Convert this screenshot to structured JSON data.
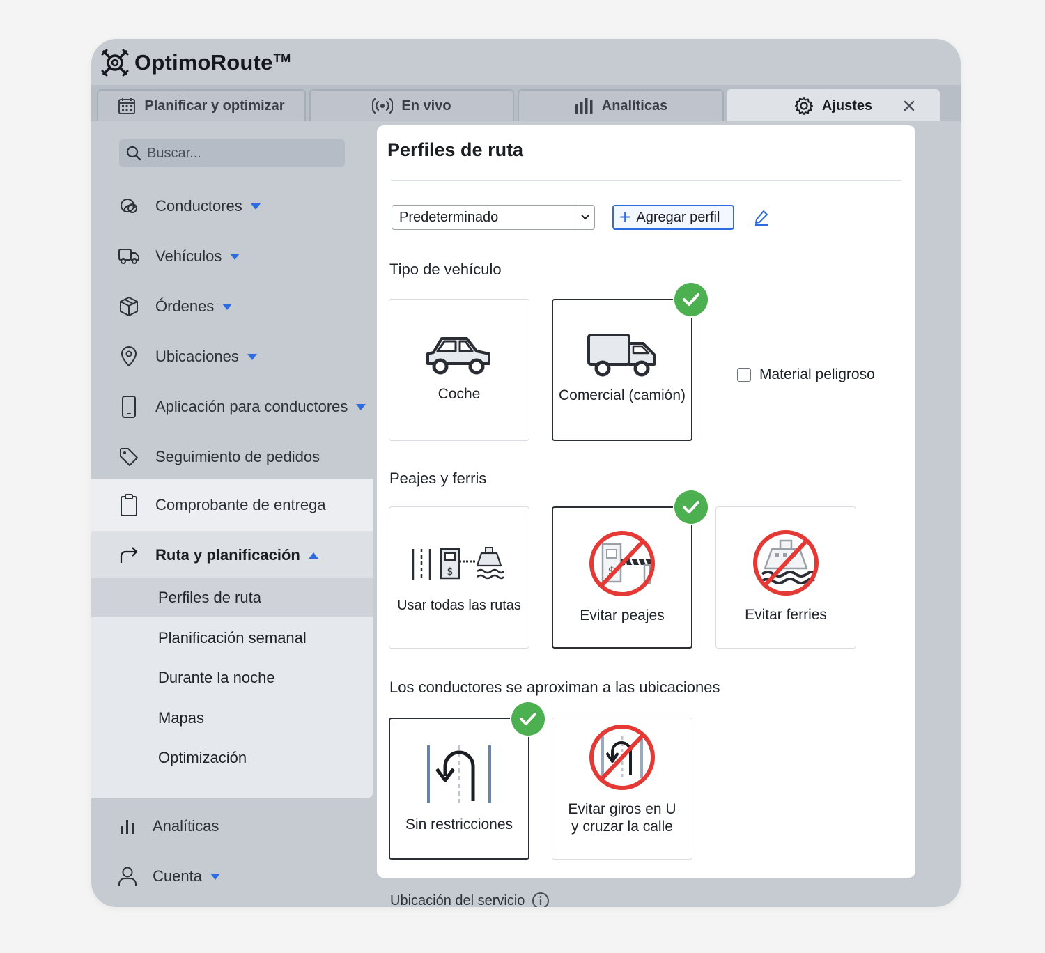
{
  "app": {
    "brand_name": "OptimoRoute",
    "brand_tm": "TM"
  },
  "tabs": [
    {
      "label": "Planificar y optimizar",
      "icon": "calendar-icon",
      "active": false
    },
    {
      "label": "En vivo",
      "icon": "broadcast-icon",
      "active": false
    },
    {
      "label": "Analíticas",
      "icon": "bar-chart-icon",
      "active": false
    },
    {
      "label": "Ajustes",
      "icon": "gear-icon",
      "active": true
    }
  ],
  "sidebar": {
    "search_placeholder": "Buscar...",
    "items": [
      {
        "label": "Conductores",
        "icon": "drivers-icon",
        "caret": "down"
      },
      {
        "label": "Vehículos",
        "icon": "truck-icon",
        "caret": "down"
      },
      {
        "label": "Órdenes",
        "icon": "box-icon",
        "caret": "down"
      },
      {
        "label": "Ubicaciones",
        "icon": "location-pin-icon",
        "caret": "down"
      },
      {
        "label": "Aplicación para conductores",
        "icon": "phone-icon",
        "caret": "down"
      },
      {
        "label": "Seguimiento de pedidos",
        "icon": "tag-icon",
        "caret": "none"
      },
      {
        "label": "Comprobante de entrega",
        "icon": "clipboard-icon",
        "caret": "none"
      },
      {
        "label": "Ruta y planificación",
        "icon": "route-arrow-icon",
        "caret": "up"
      }
    ],
    "sub_items": [
      {
        "label": "Perfiles de ruta",
        "active": true
      },
      {
        "label": "Planificación semanal",
        "active": false
      },
      {
        "label": "Durante la noche",
        "active": false
      },
      {
        "label": "Mapas",
        "active": false
      },
      {
        "label": "Optimización",
        "active": false
      }
    ],
    "bottom_items": [
      {
        "label": "Analíticas",
        "icon": "bar-chart-icon",
        "caret": "none"
      },
      {
        "label": "Cuenta",
        "icon": "user-icon",
        "caret": "down"
      }
    ]
  },
  "panel": {
    "title": "Perfiles de ruta",
    "profile_select_value": "Predeterminado",
    "add_profile_label": "Agregar perfil",
    "vehicle_section": {
      "label": "Tipo de vehículo",
      "options": [
        {
          "label": "Coche",
          "icon": "car-icon",
          "selected": false
        },
        {
          "label": "Comercial (camión)",
          "icon": "truck-icon",
          "selected": true
        }
      ],
      "hazmat_label": "Material peligroso",
      "hazmat_checked": false
    },
    "tolls_section": {
      "label": "Peajes y ferris",
      "options": [
        {
          "label": "Usar todas las rutas",
          "icon": "all-routes-icon",
          "selected": false
        },
        {
          "label": "Evitar peajes",
          "icon": "no-tolls-icon",
          "selected": true
        },
        {
          "label": "Evitar ferries",
          "icon": "no-ferries-icon",
          "selected": false
        }
      ]
    },
    "approach_section": {
      "label": "Los conductores se aproximan a las ubicaciones",
      "options": [
        {
          "label": "Sin restricciones",
          "icon": "u-turn-icon",
          "selected": true
        },
        {
          "label_line1": "Evitar giros en U",
          "label_line2": "y cruzar la calle",
          "icon": "no-u-turn-icon",
          "selected": false
        }
      ]
    },
    "service_location_label": "Ubicación del servicio"
  },
  "colors": {
    "accent_blue": "#2e6be0",
    "check_green": "#4caf50",
    "forbid_red": "#e53935",
    "window_bg": "#c6cbd2"
  }
}
